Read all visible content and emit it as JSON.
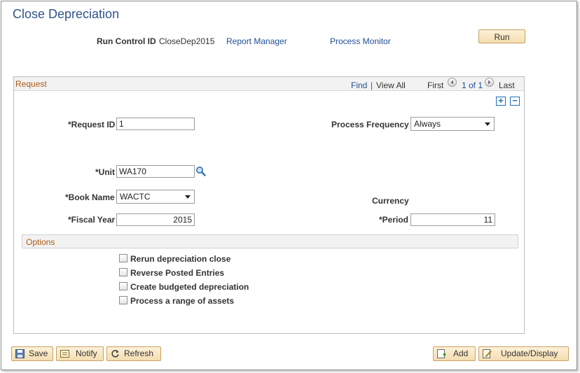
{
  "page": {
    "title": "Close Depreciation"
  },
  "header": {
    "run_control_label": "Run Control ID",
    "run_control_value": "CloseDep2015",
    "report_manager": "Report Manager",
    "process_monitor": "Process Monitor",
    "run_label": "Run"
  },
  "request": {
    "title": "Request",
    "find": "Find",
    "sep": "|",
    "view_all": "View All",
    "first": "First",
    "count": "1 of 1",
    "last": "Last",
    "add_row": "+",
    "delete_row": "−"
  },
  "fields": {
    "request_id_label": "*Request ID",
    "request_id_value": "1",
    "process_frequency_label": "Process Frequency",
    "process_frequency_value": "Always",
    "unit_label": "*Unit",
    "unit_value": "WA170",
    "book_name_label": "*Book Name",
    "book_name_value": "WACTC",
    "currency_label": "Currency",
    "fiscal_year_label": "*Fiscal Year",
    "fiscal_year_value": "2015",
    "period_label": "*Period",
    "period_value": "11"
  },
  "options": {
    "title": "Options",
    "items": [
      {
        "label": "Rerun depreciation close",
        "checked": false
      },
      {
        "label": "Reverse Posted Entries",
        "checked": false
      },
      {
        "label": "Create budgeted depreciation",
        "checked": false
      },
      {
        "label": "Process a range of assets",
        "checked": false
      }
    ]
  },
  "toolbar": {
    "save": "Save",
    "notify": "Notify",
    "refresh": "Refresh",
    "add": "Add",
    "update_display": "Update/Display"
  }
}
